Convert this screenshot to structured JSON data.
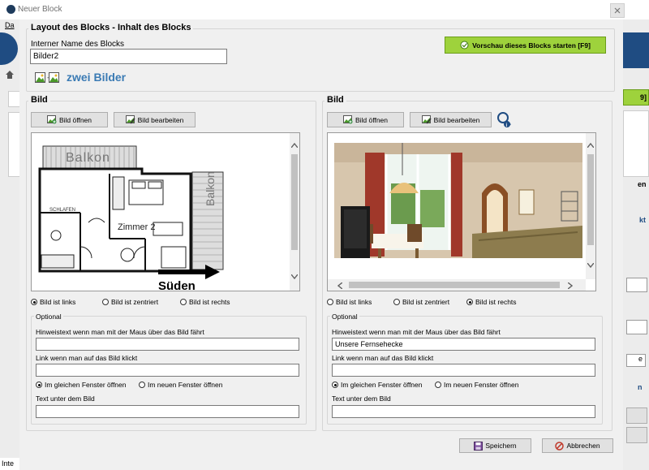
{
  "window": {
    "title": "Neuer Block"
  },
  "background": {
    "menu_partial": "Da",
    "f9_partial": "9]",
    "label_en": "en",
    "label_kt": "kt",
    "label_e": "e",
    "label_n": "n",
    "status_partial": "Inte"
  },
  "layout_group": {
    "legend": "Layout des Blocks - Inhalt des Blocks"
  },
  "name_field": {
    "label": "Interner Name des Blocks",
    "value": "Bilder2"
  },
  "block_type": {
    "label": "zwei Bilder",
    "icon": "two-images-icon"
  },
  "preview_button": {
    "label": "Vorschau dieses Blocks starten [F9]",
    "color": "#9ed23c"
  },
  "left": {
    "legend": "Bild",
    "open_label": "Bild öffnen",
    "edit_label": "Bild bearbeiten",
    "floorplan": {
      "balkon_top": "Balkon",
      "balkon_right": "Balkon",
      "schlafen": "SCHLAFEN",
      "zimmer": "Zimmer 2",
      "sueden": "Süden"
    },
    "align": {
      "left": "Bild ist links",
      "center": "Bild ist zentriert",
      "right": "Bild ist rechts",
      "selected": "left"
    },
    "optional": {
      "legend": "Optional",
      "hover_label": "Hinweistext wenn man mit der Maus über das Bild fährt",
      "hover_value": "",
      "link_label": "Link wenn man auf das Bild klickt",
      "link_value": "",
      "same_window": "Im gleichen Fenster öffnen",
      "new_window": "Im neuen Fenster öffnen",
      "caption_label": "Text unter dem Bild",
      "caption_value": ""
    }
  },
  "right": {
    "legend": "Bild",
    "open_label": "Bild öffnen",
    "edit_label": "Bild bearbeiten",
    "align": {
      "left": "Bild ist links",
      "center": "Bild ist zentriert",
      "right": "Bild ist rechts",
      "selected": "right"
    },
    "optional": {
      "legend": "Optional",
      "hover_label": "Hinweistext wenn man mit der Maus über das Bild fährt",
      "hover_value": "Unsere Fernsehecke",
      "link_label": "Link wenn man auf das Bild klickt",
      "link_value": "",
      "same_window": "Im gleichen Fenster öffnen",
      "new_window": "Im neuen Fenster öffnen",
      "caption_label": "Text unter dem Bild",
      "caption_value": ""
    }
  },
  "footer": {
    "save_label": "Speichern",
    "cancel_label": "Abbrechen"
  }
}
